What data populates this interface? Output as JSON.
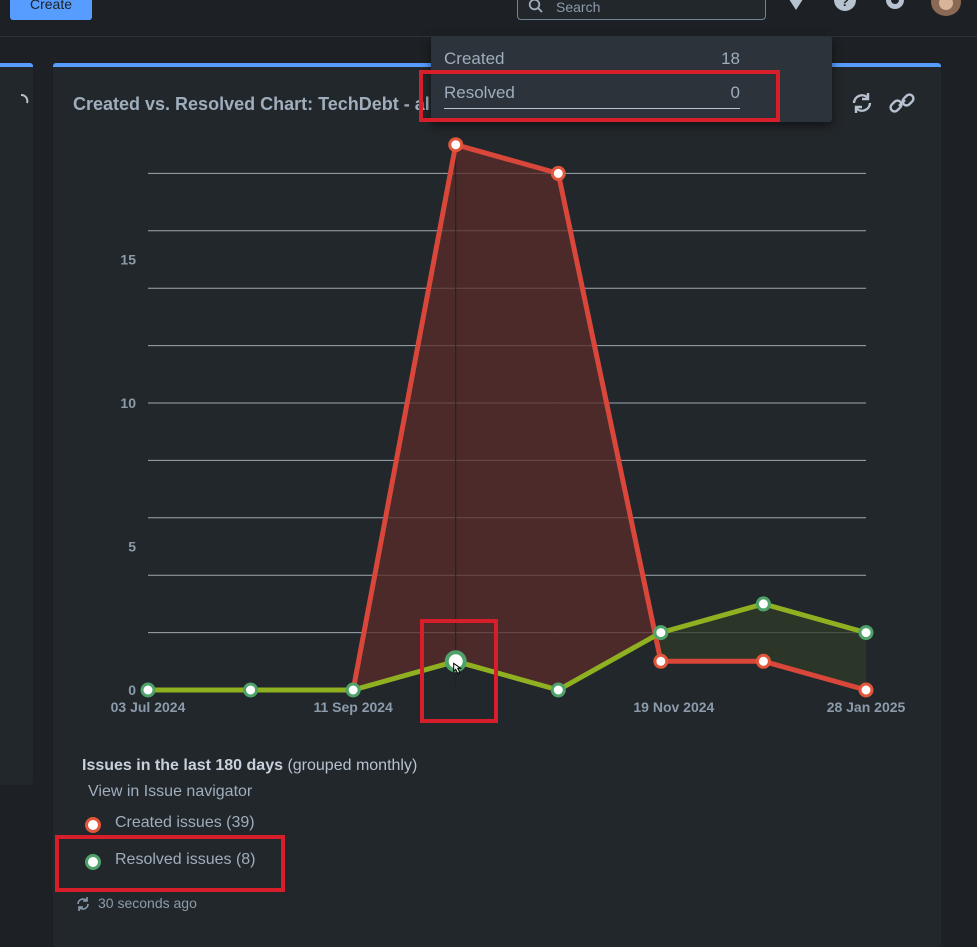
{
  "topbar": {
    "create_label": "Create",
    "search_placeholder": "Search"
  },
  "gadget": {
    "title": "Created vs. Resolved Chart: TechDebt - all squads"
  },
  "tooltip": {
    "rows": [
      {
        "label": "Created",
        "value": "18"
      },
      {
        "label": "Resolved",
        "value": "0"
      }
    ]
  },
  "chart_data": {
    "type": "area",
    "x_tick_labels": [
      "03 Jul 2024",
      "11 Sep 2024",
      "19 Nov 2024",
      "28 Jan 2025"
    ],
    "y_tick_labels": [
      "0",
      "5",
      "10",
      "15"
    ],
    "ylim": [
      0,
      19
    ],
    "grid": true,
    "series": [
      {
        "name": "Created issues",
        "color": "#e2563b",
        "values": [
          0,
          0,
          0,
          19,
          18,
          1,
          1,
          0
        ]
      },
      {
        "name": "Resolved issues",
        "color": "#8fb021",
        "values": [
          0,
          0,
          0,
          1,
          0,
          2,
          3,
          2
        ]
      }
    ]
  },
  "legend": {
    "title": "Issues in the last 180 days",
    "subtitle": "(grouped monthly)",
    "navigator_link": "View in Issue navigator",
    "items": [
      {
        "label": "Created issues (39)",
        "color": "#e2563b"
      },
      {
        "label": "Resolved issues (8)",
        "color": "#4fa36a"
      }
    ],
    "refreshed": "30 seconds ago"
  }
}
